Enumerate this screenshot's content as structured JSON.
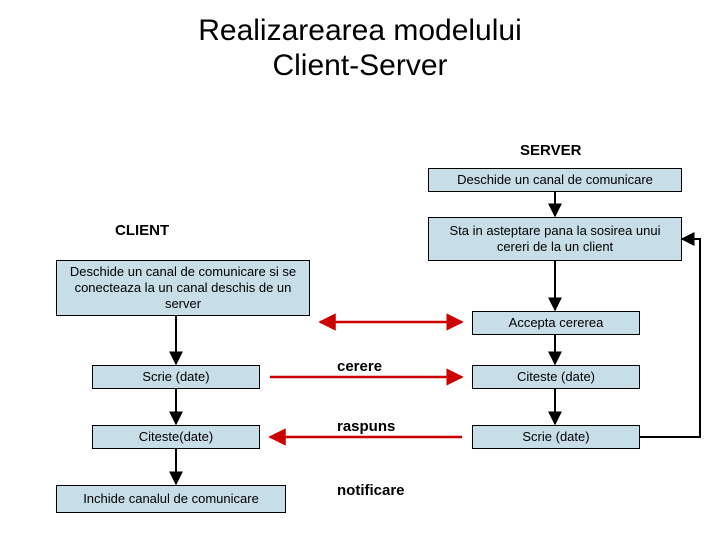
{
  "title_line1": "Realizarearea modelului",
  "title_line2": "Client-Server",
  "labels": {
    "server": "SERVER",
    "client": "CLIENT"
  },
  "server_boxes": {
    "open": "Deschide un canal de comunicare",
    "wait": "Sta in asteptare pana la sosirea unui cereri de la un client",
    "accept": "Accepta cererea",
    "read": "Citeste (date)",
    "write": "Scrie (date)"
  },
  "client_boxes": {
    "connect": "Deschide un canal de comunicare si se conecteaza la un canal deschis de un server",
    "write": "Scrie (date)",
    "read": "Citeste(date)",
    "close": "Inchide canalul de comunicare"
  },
  "messages": {
    "cerere": "cerere",
    "raspuns": "raspuns",
    "notificare": "notificare"
  },
  "colors": {
    "box_fill": "#c7dde8",
    "arrow_red": "#cc0000",
    "arrow_black": "#000000"
  }
}
